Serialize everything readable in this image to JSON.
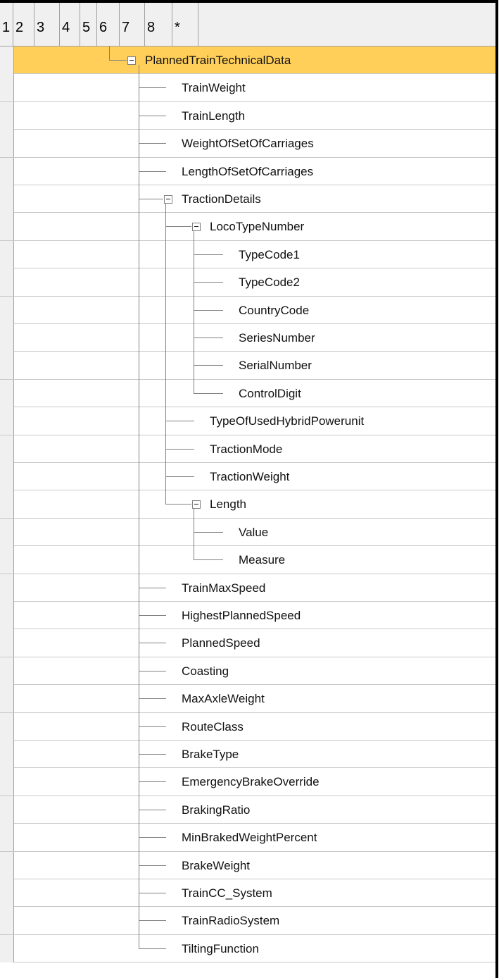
{
  "columns": [
    "1",
    "2",
    "3",
    "4",
    "5",
    "6",
    "7",
    "8",
    "*"
  ],
  "colors": {
    "selection": "#ffcf5a",
    "tree_lines": "#808080",
    "grid": "#c8c8c8"
  },
  "tree": [
    {
      "label": "PlannedTrainTechnicalData",
      "level": 0,
      "expanded": true,
      "selected": true
    },
    {
      "label": "TrainWeight",
      "level": 1
    },
    {
      "label": "TrainLength",
      "level": 1
    },
    {
      "label": "WeightOfSetOfCarriages",
      "level": 1
    },
    {
      "label": "LengthOfSetOfCarriages",
      "level": 1
    },
    {
      "label": "TractionDetails",
      "level": 1,
      "expanded": true
    },
    {
      "label": "LocoTypeNumber",
      "level": 2,
      "expanded": true
    },
    {
      "label": "TypeCode1",
      "level": 3
    },
    {
      "label": "TypeCode2",
      "level": 3
    },
    {
      "label": "CountryCode",
      "level": 3
    },
    {
      "label": "SeriesNumber",
      "level": 3
    },
    {
      "label": "SerialNumber",
      "level": 3
    },
    {
      "label": "ControlDigit",
      "level": 3
    },
    {
      "label": "TypeOfUsedHybridPowerunit",
      "level": 2
    },
    {
      "label": "TractionMode",
      "level": 2
    },
    {
      "label": "TractionWeight",
      "level": 2
    },
    {
      "label": "Length",
      "level": 2,
      "expanded": true
    },
    {
      "label": "Value",
      "level": 3
    },
    {
      "label": "Measure",
      "level": 3
    },
    {
      "label": "TrainMaxSpeed",
      "level": 1
    },
    {
      "label": "HighestPlannedSpeed",
      "level": 1
    },
    {
      "label": "PlannedSpeed",
      "level": 1
    },
    {
      "label": "Coasting",
      "level": 1
    },
    {
      "label": "MaxAxleWeight",
      "level": 1
    },
    {
      "label": "RouteClass",
      "level": 1
    },
    {
      "label": "BrakeType",
      "level": 1
    },
    {
      "label": "EmergencyBrakeOverride",
      "level": 1
    },
    {
      "label": "BrakingRatio",
      "level": 1
    },
    {
      "label": "MinBrakedWeightPercent",
      "level": 1
    },
    {
      "label": "BrakeWeight",
      "level": 1
    },
    {
      "label": "TrainCC_System",
      "level": 1
    },
    {
      "label": "TrainRadioSystem",
      "level": 1
    },
    {
      "label": "TiltingFunction",
      "level": 1
    }
  ]
}
